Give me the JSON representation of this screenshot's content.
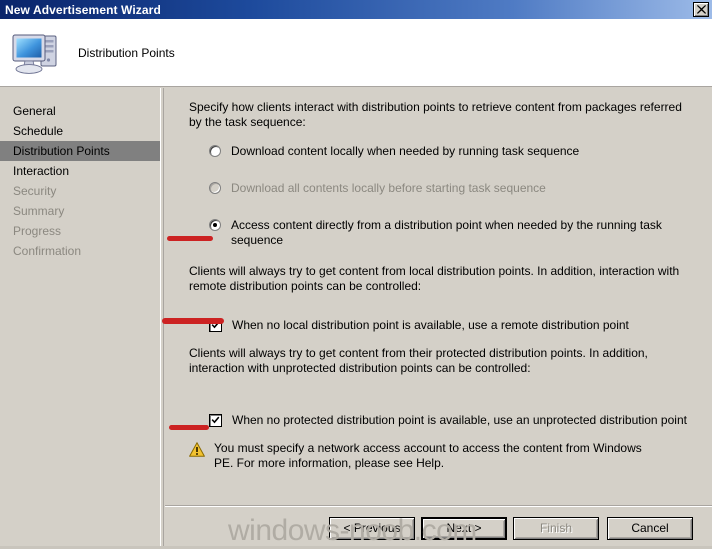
{
  "window": {
    "title": "New Advertisement Wizard",
    "close_label": "Close",
    "close_icon": "close-icon"
  },
  "header": {
    "title": "Distribution Points",
    "icon": "computer-icon"
  },
  "sidebar": {
    "items": [
      {
        "label": "General",
        "state": "normal"
      },
      {
        "label": "Schedule",
        "state": "normal"
      },
      {
        "label": "Distribution Points",
        "state": "selected"
      },
      {
        "label": "Interaction",
        "state": "normal"
      },
      {
        "label": "Security",
        "state": "disabled"
      },
      {
        "label": "Summary",
        "state": "disabled"
      },
      {
        "label": "Progress",
        "state": "disabled"
      },
      {
        "label": "Confirmation",
        "state": "disabled"
      }
    ]
  },
  "main": {
    "intro": "Specify how clients interact with distribution points to retrieve content from packages referred by the task sequence:",
    "radios": [
      {
        "label": "Download content locally when needed by running task sequence",
        "checked": false,
        "disabled": false
      },
      {
        "label": "Download all contents locally before starting task sequence",
        "checked": false,
        "disabled": true
      },
      {
        "label": "Access content directly from a distribution point when needed by the running task sequence",
        "checked": true,
        "disabled": false
      }
    ],
    "paragraph_local": "Clients will always try to get content from local distribution points. In addition, interaction with remote distribution points can be controlled:",
    "checkbox_remote": {
      "label": "When no local distribution point is available, use a remote distribution point",
      "checked": true
    },
    "paragraph_protected": "Clients will always try to get content from their protected distribution points. In addition, interaction with unprotected distribution points can be controlled:",
    "checkbox_unprotected": {
      "label": "When no protected distribution point is available, use an unprotected distribution point",
      "checked": true
    },
    "warning": {
      "icon": "warning-triangle-icon",
      "text": "You must specify a network access account to access the content from Windows PE.  For more information, please see Help."
    }
  },
  "footer": {
    "buttons": [
      {
        "label": "< Previous",
        "state": "normal"
      },
      {
        "label": "Next >",
        "state": "default"
      },
      {
        "label": "Finish",
        "state": "disabled"
      },
      {
        "label": "Cancel",
        "state": "normal"
      }
    ]
  },
  "watermark": {
    "text": "windows-noob.com"
  },
  "colors": {
    "titlebar_start": "#0a246a",
    "titlebar_end": "#9dbbe8",
    "dialog_face": "#d4d0c8",
    "selection": "#808080",
    "annotation_red": "#cc2222",
    "warning_yellow": "#ffcc00"
  }
}
